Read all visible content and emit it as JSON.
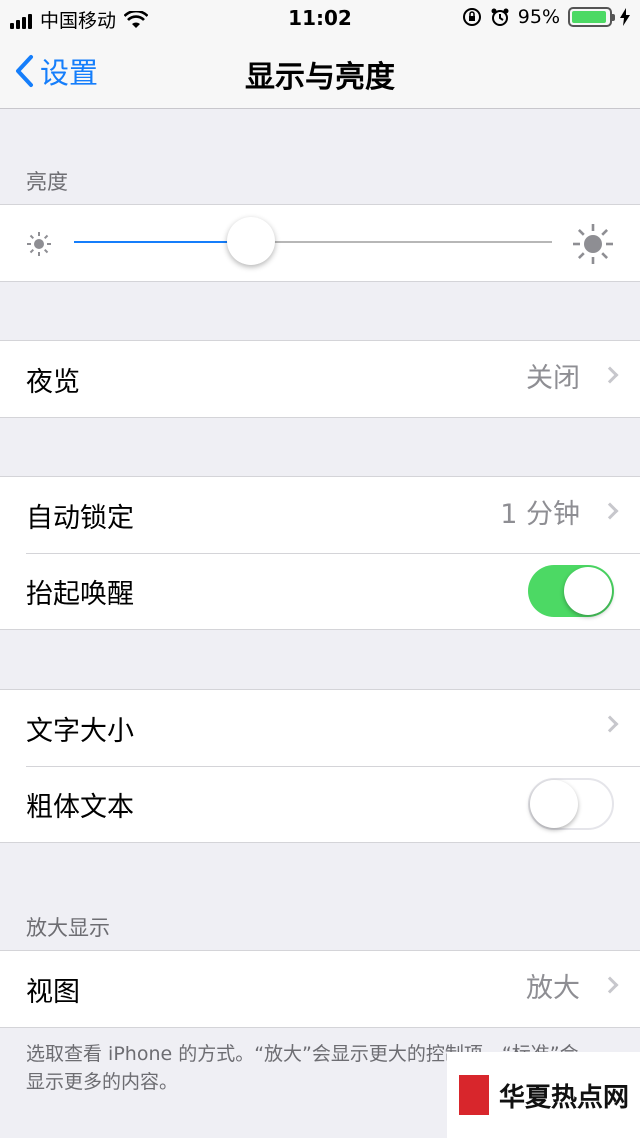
{
  "status_bar": {
    "carrier": "中国移动",
    "time": "11:02",
    "battery": "95%",
    "battery_level": 0.95
  },
  "nav": {
    "back_label": "设置",
    "title": "显示与亮度"
  },
  "brightness": {
    "header": "亮度",
    "level": 0.37
  },
  "night_shift": {
    "label": "夜览",
    "value": "关闭"
  },
  "auto_lock": {
    "label": "自动锁定",
    "value": "1 分钟"
  },
  "raise_to_wake": {
    "label": "抬起唤醒",
    "on": true
  },
  "text_size": {
    "label": "文字大小"
  },
  "bold_text": {
    "label": "粗体文本",
    "on": false
  },
  "zoom": {
    "header": "放大显示",
    "label": "视图",
    "value": "放大",
    "footer": "选取查看 iPhone 的方式。“放大”会显示更大的控制项。“标准”会显示更多的内容。"
  },
  "watermark": {
    "text": "华夏热点网"
  },
  "colors": {
    "accent": "#157efb",
    "toggle_on": "#4cd964"
  }
}
